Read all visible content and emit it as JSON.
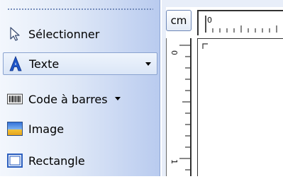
{
  "toolbar": {
    "tools": [
      {
        "label": "Sélectionner",
        "icon": "cursor-icon"
      },
      {
        "label": "Texte",
        "icon": "text-tool-icon",
        "has_dropdown": true
      },
      {
        "label": "Code à barres",
        "icon": "barcode-icon",
        "has_dropdown": true
      },
      {
        "label": "Image",
        "icon": "image-icon"
      },
      {
        "label": "Rectangle",
        "icon": "rectangle-icon"
      }
    ]
  },
  "ruler": {
    "unit_button": "cm",
    "horizontal_origin": "0",
    "vertical_labels": [
      "0",
      "1"
    ]
  },
  "colors": {
    "toolbar_light": "#f3f7fd",
    "toolbar_dark": "#b9cbef",
    "text_tool_blue": "#1f56c8",
    "border_blue": "#8aa3d0"
  }
}
